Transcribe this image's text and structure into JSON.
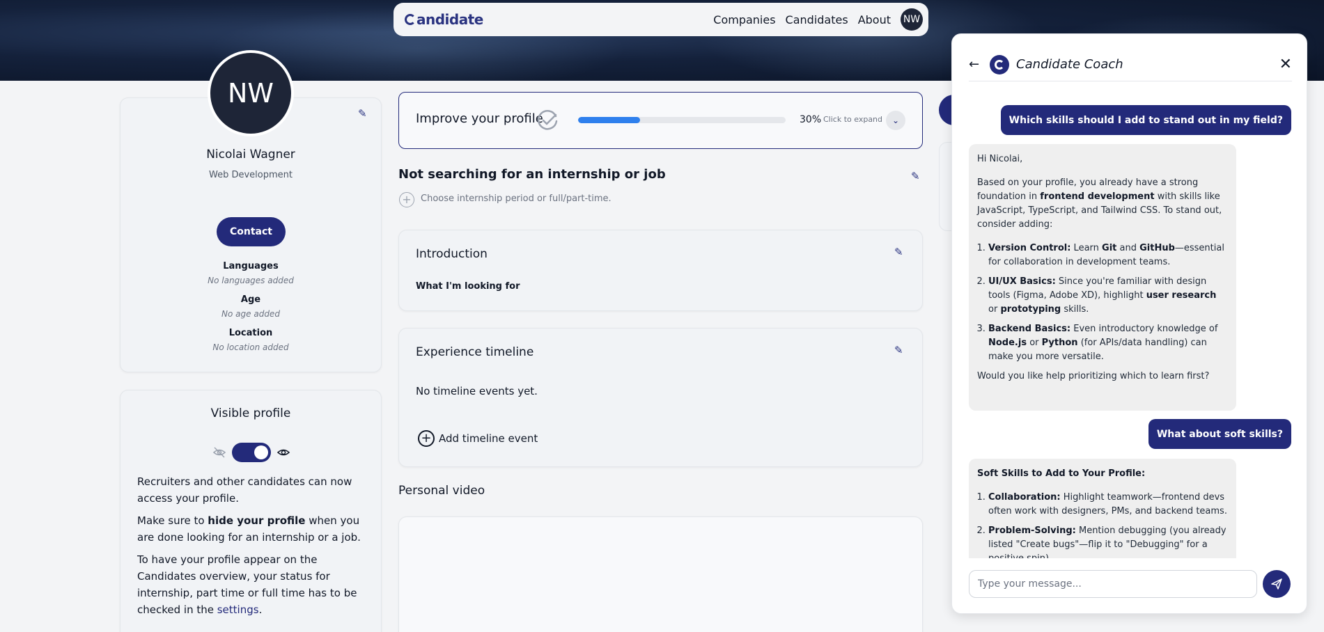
{
  "nav": {
    "logo": "andidate",
    "links": [
      "Companies",
      "Candidates",
      "About"
    ],
    "avatar_initials": "NW"
  },
  "profile": {
    "initials": "NW",
    "name": "Nicolai Wagner",
    "field": "Web Development",
    "contact_label": "Contact",
    "languages_label": "Languages",
    "languages_value": "No languages added",
    "age_label": "Age",
    "age_value": "No age added",
    "location_label": "Location",
    "location_value": "No location added"
  },
  "visibility": {
    "title": "Visible profile",
    "toggle_on": true,
    "p1": "Recruiters and other candidates can now access your profile.",
    "p2_pre": "Make sure to ",
    "p2_bold": "hide your profile",
    "p2_post": " when you are done looking for an internship or a job.",
    "p3_pre": "To have your profile appear on the Candidates overview, your status for internship, part time or full time has to be checked in the ",
    "p3_link": "settings",
    "p3_post": "."
  },
  "improve": {
    "title": "Improve your profile",
    "progress": 0.3,
    "progress_label": "30%",
    "hint": "Click to expand"
  },
  "status": {
    "title": "Not searching for an internship or job",
    "hint": "Choose internship period or full/part-time."
  },
  "introduction": {
    "title": "Introduction",
    "subtitle": "What I'm looking for"
  },
  "experience": {
    "title": "Experience timeline",
    "empty": "No timeline events yet.",
    "add_label": "Add timeline event"
  },
  "video": {
    "title": "Personal video"
  },
  "chat": {
    "title": "Candidate Coach",
    "user_msg_1": "Which skills should I add to stand out in my field?",
    "bot_1": {
      "greeting": "Hi Nicolai,",
      "intro_pre": "Based on your profile, you already have a strong foundation in ",
      "intro_bold": "frontend development",
      "intro_post": " with skills like JavaScript, TypeScript, and Tailwind CSS. To stand out, consider adding:",
      "items": [
        {
          "head": "Version Control:",
          "t1": " Learn ",
          "b1": "Git",
          "t2": " and ",
          "b2": "GitHub",
          "t3": "—essential for collaboration in development teams."
        },
        {
          "head": "UI/UX Basics:",
          "t1": " Since you're familiar with design tools (Figma, Adobe XD), highlight ",
          "b1": "user research",
          "t2": " or ",
          "b2": "prototyping",
          "t3": " skills."
        },
        {
          "head": "Backend Basics:",
          "t1": " Even introductory knowledge of ",
          "b1": "Node.js",
          "t2": " or ",
          "b2": "Python",
          "t3": " (for APIs/data handling) can make you more versatile."
        }
      ],
      "closing": "Would you like help prioritizing which to learn first?"
    },
    "user_msg_2": "What about soft skills?",
    "bot_2": {
      "heading": "Soft Skills to Add to Your Profile:",
      "items": [
        {
          "head": "Collaboration:",
          "text": " Highlight teamwork—frontend devs often work with designers, PMs, and backend teams."
        },
        {
          "head": "Problem-Solving:",
          "text": " Mention debugging (you already listed \"Create bugs\"—flip it to \"Debugging\" for a positive spin)."
        }
      ]
    },
    "input_placeholder": "Type your message..."
  }
}
